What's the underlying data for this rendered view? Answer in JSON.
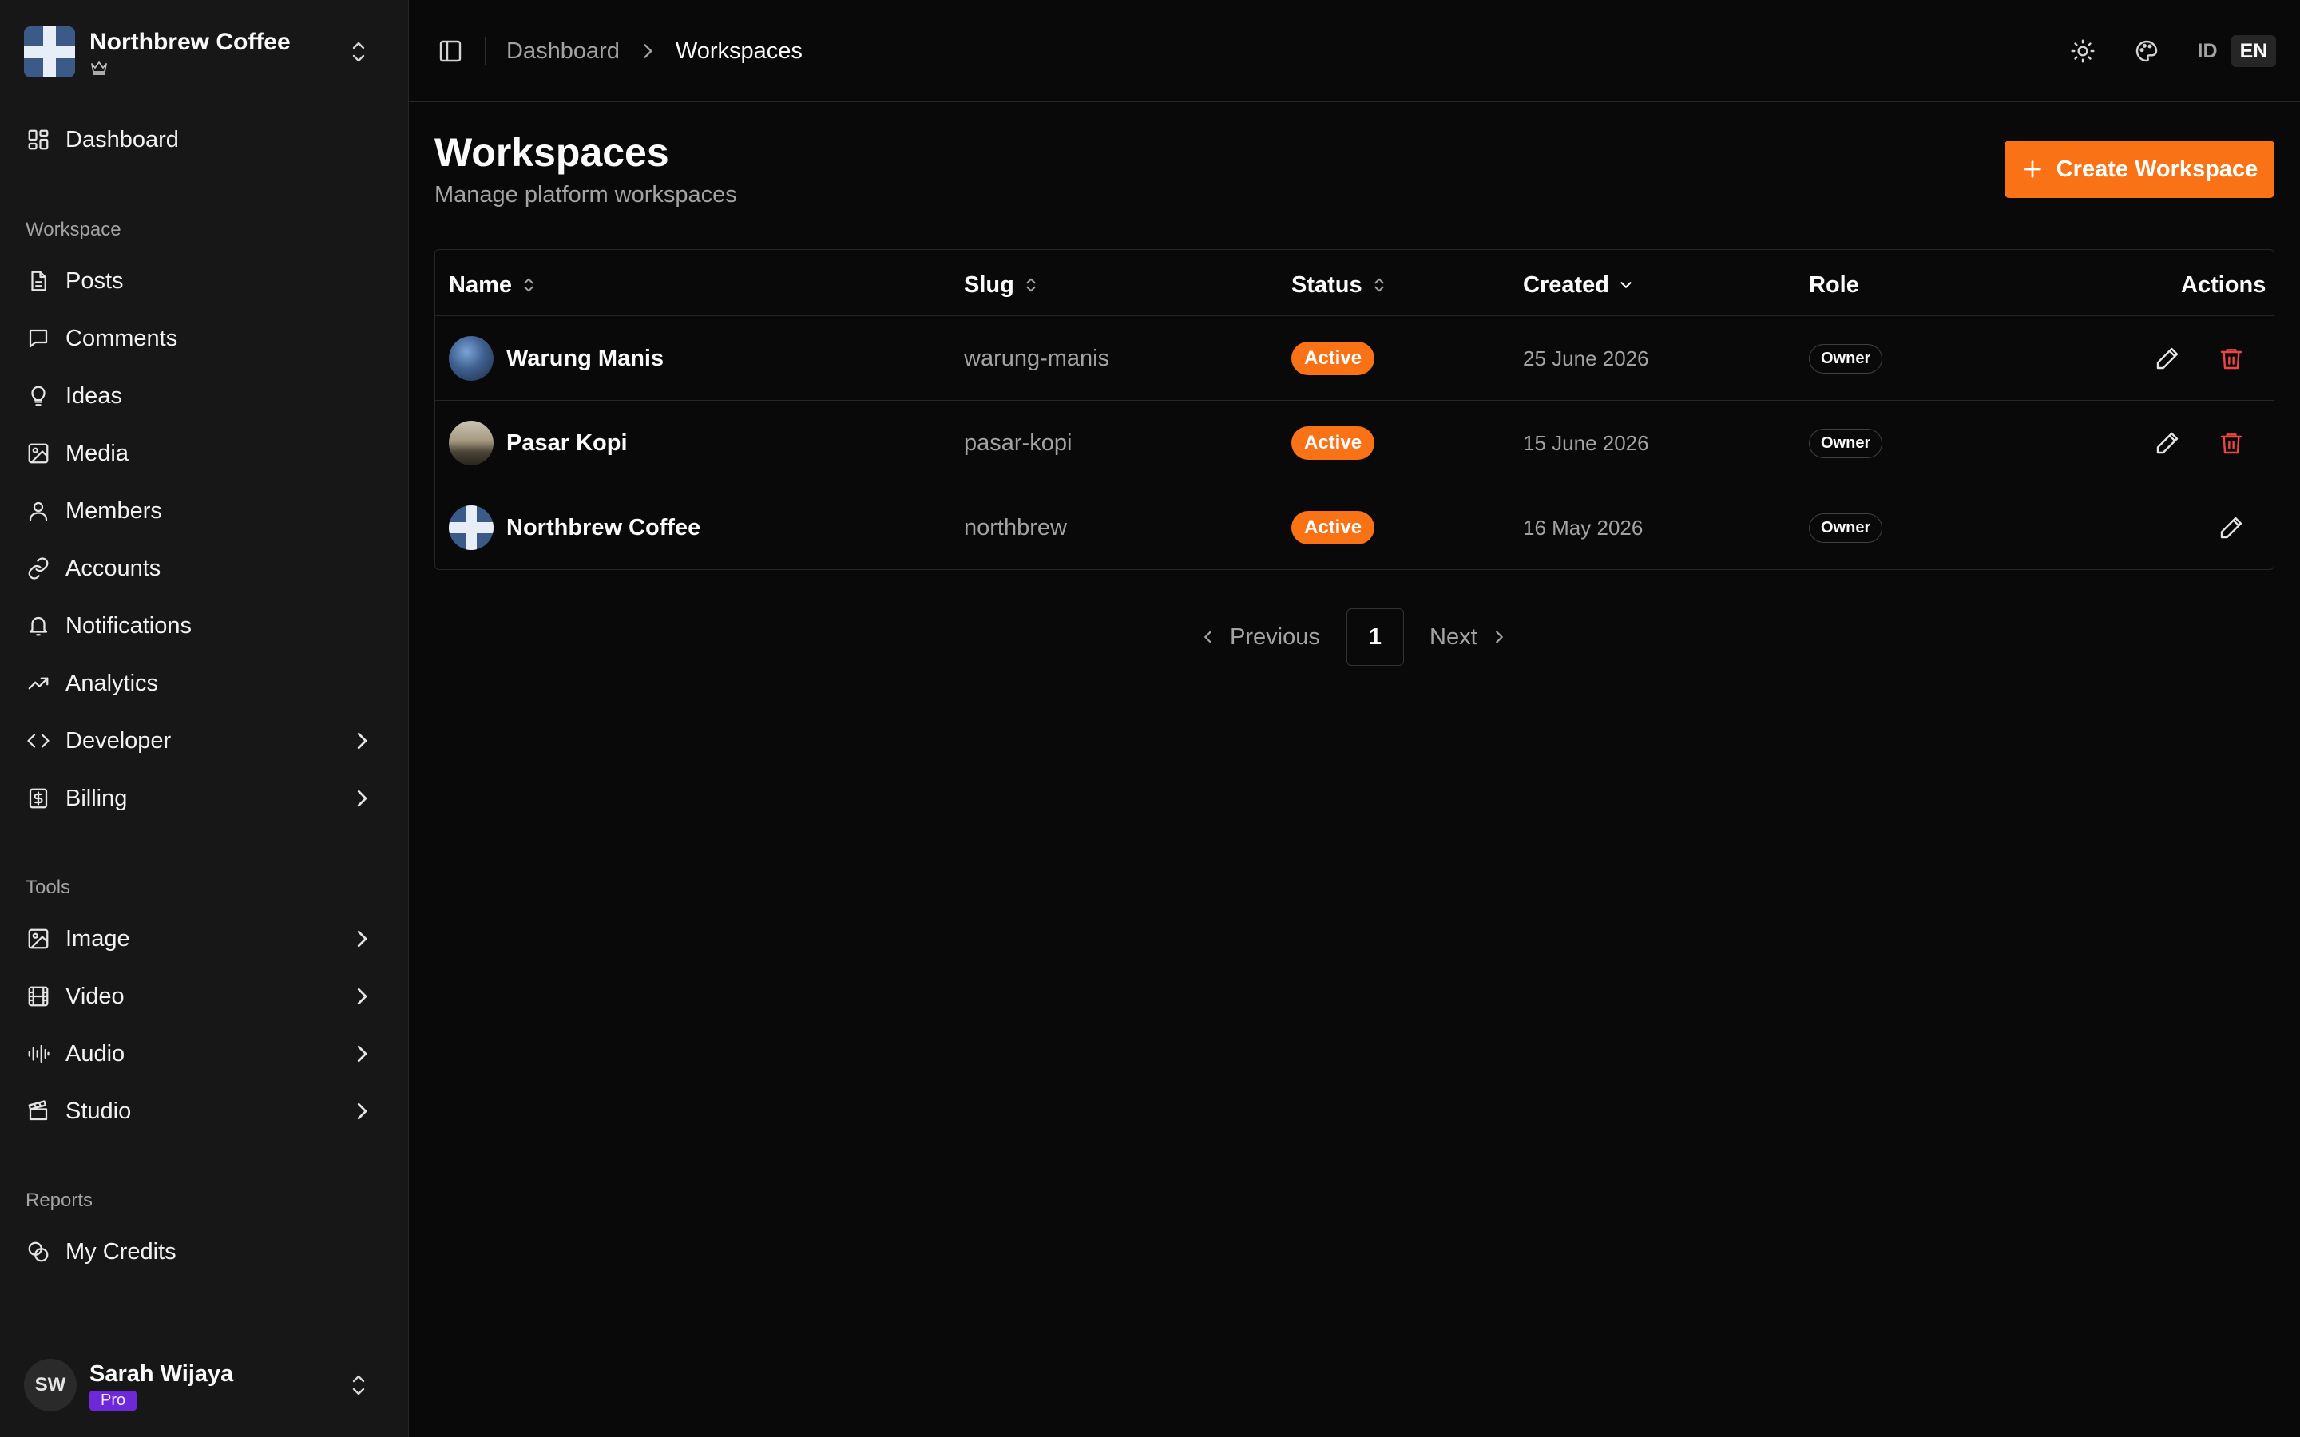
{
  "workspace": {
    "name": "Northbrew Coffee"
  },
  "sidebar": {
    "top_items": [
      {
        "label": "Dashboard",
        "icon": "dashboard-icon"
      }
    ],
    "group_workspace": "Workspace",
    "workspace_items": [
      {
        "label": "Posts",
        "icon": "document-icon"
      },
      {
        "label": "Comments",
        "icon": "comment-icon"
      },
      {
        "label": "Ideas",
        "icon": "lightbulb-icon"
      },
      {
        "label": "Media",
        "icon": "image-icon"
      },
      {
        "label": "Members",
        "icon": "user-icon"
      },
      {
        "label": "Accounts",
        "icon": "link-icon"
      },
      {
        "label": "Notifications",
        "icon": "bell-icon"
      },
      {
        "label": "Analytics",
        "icon": "trending-icon"
      },
      {
        "label": "Developer",
        "icon": "code-icon"
      },
      {
        "label": "Billing",
        "icon": "dollar-icon"
      }
    ],
    "group_tools": "Tools",
    "tools_items": [
      {
        "label": "Image",
        "icon": "image-icon"
      },
      {
        "label": "Video",
        "icon": "film-icon"
      },
      {
        "label": "Audio",
        "icon": "audio-wave-icon"
      },
      {
        "label": "Studio",
        "icon": "clapperboard-icon"
      }
    ],
    "group_reports": "Reports",
    "reports_items": [
      {
        "label": "My Credits",
        "icon": "coins-icon"
      }
    ],
    "user": {
      "initials": "SW",
      "name": "Sarah Wijaya",
      "plan": "Pro"
    }
  },
  "header": {
    "breadcrumb_root": "Dashboard",
    "breadcrumb_current": "Workspaces",
    "lang_id": "ID",
    "lang_en": "EN"
  },
  "main": {
    "title": "Workspaces",
    "subtitle": "Manage platform workspaces",
    "create_label": "Create Workspace",
    "columns": {
      "name": "Name",
      "slug": "Slug",
      "status": "Status",
      "created": "Created",
      "role": "Role",
      "actions": "Actions"
    },
    "rows": [
      {
        "name": "Warung Manis",
        "slug": "warung-manis",
        "status": "Active",
        "created": "25 June 2026",
        "role": "Owner"
      },
      {
        "name": "Pasar Kopi",
        "slug": "pasar-kopi",
        "status": "Active",
        "created": "15 June 2026",
        "role": "Owner"
      },
      {
        "name": "Northbrew Coffee",
        "slug": "northbrew",
        "status": "Active",
        "created": "16 May 2026",
        "role": "Owner"
      }
    ],
    "pagination": {
      "previous": "Previous",
      "page": "1",
      "next": "Next"
    }
  },
  "colors": {
    "accent": "#f97316",
    "danger": "#ef4444",
    "pro": "#6d28d9",
    "background": "#0a0909",
    "sidebar": "#171717"
  }
}
